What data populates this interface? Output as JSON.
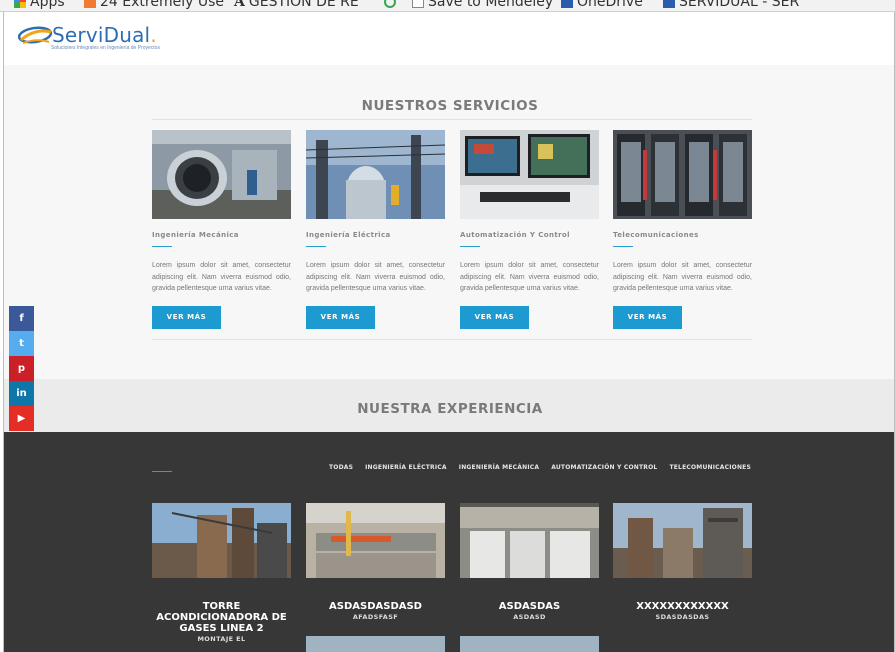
{
  "bookmarks": [
    {
      "label": "Apps",
      "icon": "apps-grid-icon",
      "color": "#e8453c"
    },
    {
      "label": "24 Extremely Use",
      "icon": "bookmark-favicon-icon",
      "color": "#f07a2f"
    },
    {
      "label": "GESTIÓN DE RE",
      "icon": "text-a-icon",
      "color": "#333333"
    },
    {
      "label": "",
      "icon": "chrome-like-icon",
      "color": "#34a853"
    },
    {
      "label": "Save to Mendeley",
      "icon": "page-icon",
      "color": "#888888"
    },
    {
      "label": "OneDrive",
      "icon": "onedrive-icon",
      "color": "#2b5dad"
    },
    {
      "label": "SERVIDUAL - SER",
      "icon": "servidual-favicon-icon",
      "color": "#2b5dad"
    }
  ],
  "logo": {
    "name": "ServiDual",
    "dot": ".",
    "tagline": "Soluciones Integrales en Ingeniería de Proyectos"
  },
  "services": {
    "title": "NUESTROS SERVICIOS",
    "cards": [
      {
        "name": "Ingeniería Mecánica",
        "desc": "Lorem ipsum dolor sit amet, consectetur adipiscing elit. Nam viverra euismod odio, gravida pellentesque urna varius vitae.",
        "button": "VER MÁS"
      },
      {
        "name": "Ingeniería Eléctrica",
        "desc": "Lorem ipsum dolor sit amet, consectetur adipiscing elit. Nam viverra euismod odio, gravida pellentesque urna varius vitae.",
        "button": "VER MÁS"
      },
      {
        "name": "Automatización Y Control",
        "desc": "Lorem ipsum dolor sit amet, consectetur adipiscing elit. Nam viverra euismod odio, gravida pellentesque urna varius vitae.",
        "button": "VER MÁS"
      },
      {
        "name": "Telecomunicaciones",
        "desc": "Lorem ipsum dolor sit amet, consectetur adipiscing elit. Nam viverra euismod odio, gravida pellentesque urna varius vitae.",
        "button": "VER MÁS"
      }
    ]
  },
  "experience": {
    "title": "NUESTRA EXPERIENCIA",
    "filters": [
      "TODAS",
      "INGENIERÍA ELÉCTRICA",
      "INGENIERÍA MECÁNICA",
      "AUTOMATIZACIÓN Y CONTROL",
      "TELECOMUNICACIONES"
    ],
    "projects": [
      {
        "title": "TORRE ACONDICIONADORA DE GASES LINEA 2",
        "subtitle": "MONTAJE EL"
      },
      {
        "title": "ASDASDASDASD",
        "subtitle": "AFADSFASF"
      },
      {
        "title": "ASDASDAS",
        "subtitle": "ASDASD"
      },
      {
        "title": "XXXXXXXXXXXX",
        "subtitle": "SDASDASDAS"
      }
    ]
  },
  "social": [
    {
      "glyph": "f",
      "icon": "facebook-icon",
      "color": "#3b5998"
    },
    {
      "glyph": "t",
      "icon": "twitter-icon",
      "color": "#55acee"
    },
    {
      "glyph": "p",
      "icon": "pinterest-icon",
      "color": "#cb2027"
    },
    {
      "glyph": "in",
      "icon": "linkedin-icon",
      "color": "#0e76a8"
    },
    {
      "glyph": "▶",
      "icon": "youtube-icon",
      "color": "#e52d27"
    }
  ],
  "colors": {
    "accent": "#1d9bd1",
    "dark": "#373737"
  }
}
